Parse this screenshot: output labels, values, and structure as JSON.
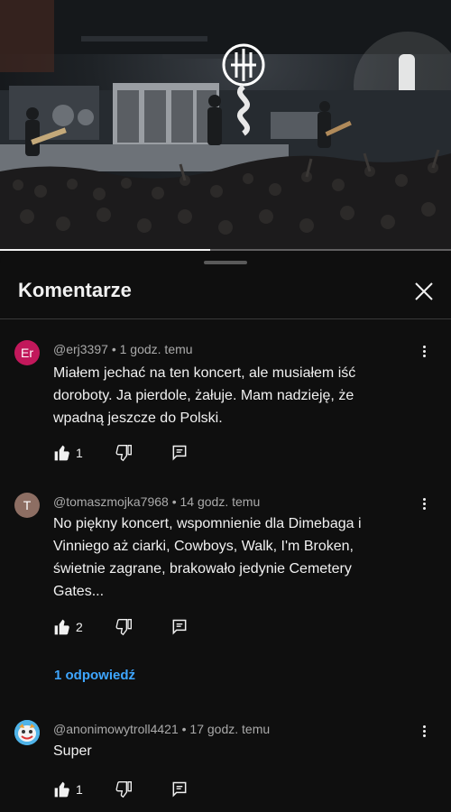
{
  "video": {
    "progress_fraction": 0.465,
    "band_logo": "pantera-logo"
  },
  "sheet": {
    "title": "Komentarze",
    "close_icon": "close-icon"
  },
  "colors": {
    "background": "#0f0f0f",
    "text": "#f1f1f1",
    "muted": "#aaaaaa",
    "link": "#3ea6ff"
  },
  "comments": [
    {
      "avatar_letter": "Er",
      "avatar_color": "#c2185b",
      "author": "@erj3397",
      "time": "1 godz. temu",
      "lines": [
        "Miałem jechać na ten koncert, ale musiałem iść",
        "doroboty. Ja pierdole, żałuje. Mam nadzieję, że",
        "wpadną jeszcze do Polski."
      ],
      "likes": "1"
    },
    {
      "avatar_letter": "T",
      "avatar_color": "#8d6e63",
      "author": "@tomaszmojka7968",
      "time": "14 godz. temu",
      "lines": [
        "No piękny koncert, wspomnienie dla Dimebaga i",
        "Vinniego aż ciarki, Cowboys, Walk, I'm Broken,",
        "świetnie zagrane, brakowało jedynie Cemetery",
        "Gates..."
      ],
      "likes": "2",
      "replies": "1 odpowiedź"
    },
    {
      "avatar_letter": "",
      "avatar_color": "#4fb3e8",
      "author": "@anonimowytroll4421",
      "time": "17 godz. temu",
      "lines": [
        "Super"
      ],
      "likes": "1"
    }
  ]
}
